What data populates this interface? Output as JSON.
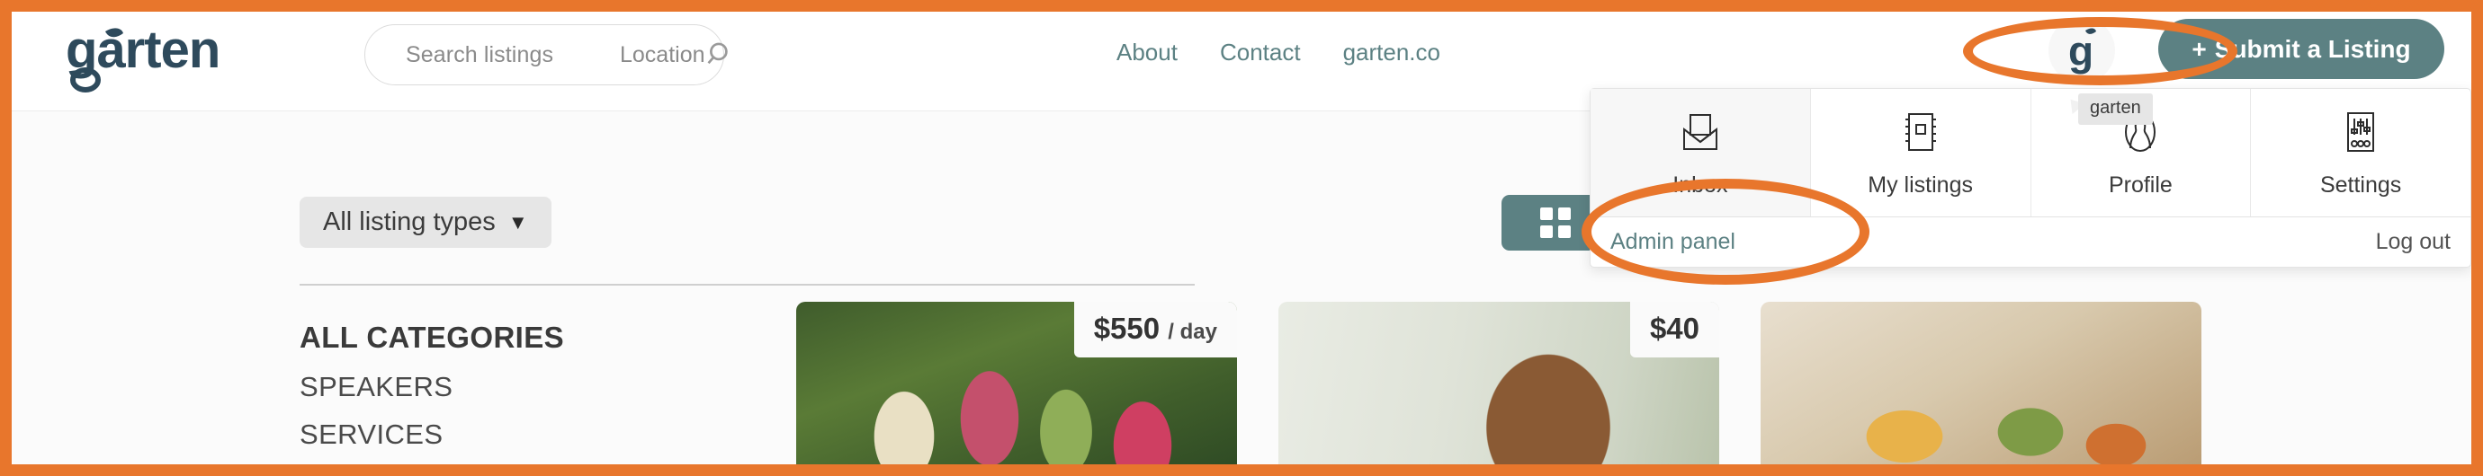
{
  "brand": {
    "name": "garten",
    "accent_teal": "#5c8183",
    "logo_navy": "#2e4a5c",
    "annotation_orange": "#e8762c"
  },
  "header": {
    "logo_text": "garten",
    "search": {
      "listings_placeholder": "Search listings",
      "location_placeholder": "Location",
      "search_icon": "search-icon"
    },
    "nav_links": [
      {
        "label": "About"
      },
      {
        "label": "Contact"
      },
      {
        "label": "garten.co"
      }
    ],
    "avatar": {
      "icon": "garten-g-avatar-icon",
      "tooltip": "garten"
    },
    "submit_button": {
      "plus": "+",
      "label": "Submit a Listing"
    }
  },
  "toolbar": {
    "listing_types_label": "All listing types",
    "caret": "▼",
    "view_toggle_icon": "grid-view-icon"
  },
  "categories": {
    "heading": "ALL CATEGORIES",
    "items": [
      {
        "label": "SPEAKERS"
      },
      {
        "label": "SERVICES"
      }
    ]
  },
  "listings": [
    {
      "price": "$550",
      "per": "/ day",
      "image": "smoothies-photo"
    },
    {
      "price": "$40",
      "per": "",
      "image": "woman-portrait-photo"
    },
    {
      "price": "",
      "per": "",
      "image": "food-table-photo"
    }
  ],
  "user_menu": {
    "items": [
      {
        "label": "Inbox",
        "icon": "envelope-open-icon",
        "active": true
      },
      {
        "label": "My listings",
        "icon": "notebook-icon",
        "active": false
      },
      {
        "label": "Profile",
        "icon": "person-portrait-icon",
        "active": false
      },
      {
        "label": "Settings",
        "icon": "sliders-icon",
        "active": false
      }
    ],
    "admin_link": "Admin panel",
    "logout_link": "Log out"
  }
}
